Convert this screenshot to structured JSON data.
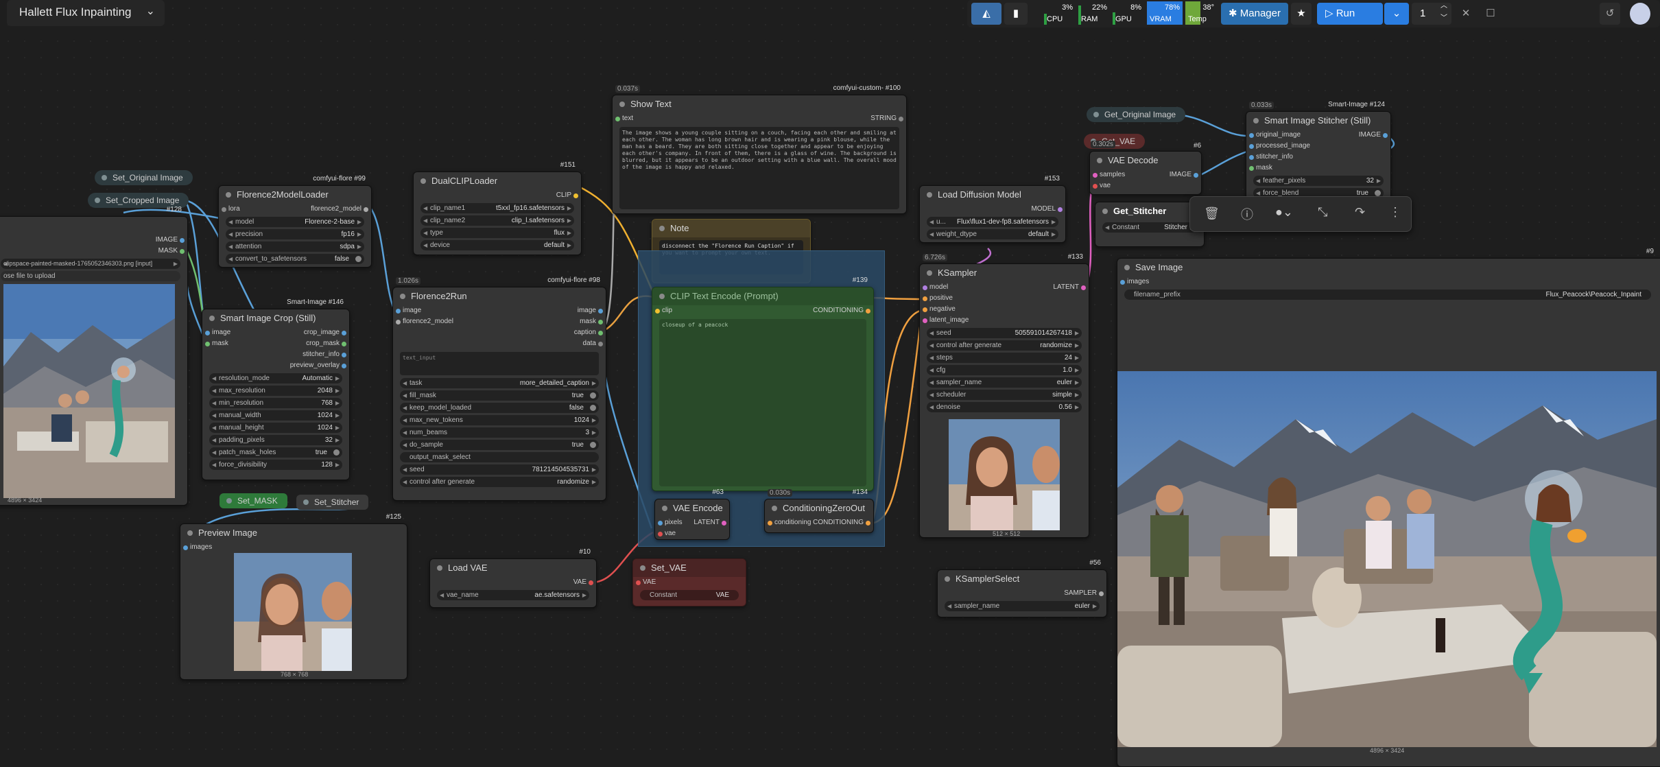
{
  "workflow": {
    "title": "Hallett Flux Inpainting"
  },
  "toolbar": {
    "stats": [
      {
        "label": "CPU",
        "value": "3%",
        "color": "#2ea043"
      },
      {
        "label": "RAM",
        "value": "22%",
        "color": "#2ea043"
      },
      {
        "label": "GPU",
        "value": "8%",
        "color": "#2ea043"
      },
      {
        "label": "VRAM",
        "value": "78%",
        "color": "#2a7de1"
      },
      {
        "label": "Temp",
        "value": "38°",
        "color": "#6fa83a"
      }
    ],
    "manager_label": "Manager",
    "run_label": "Run",
    "queue_count": "1"
  },
  "nodes": {
    "set_original": {
      "title": "Set_Original Image"
    },
    "set_cropped": {
      "title": "Set_Cropped Image"
    },
    "load_image": {
      "id": "#128",
      "outputs": [
        "IMAGE",
        "MASK"
      ],
      "filename": "clipspace-painted-masked-1765052346303.png [input]",
      "upload": "ose file to upload",
      "size": "4896 × 3424"
    },
    "florence_loader": {
      "title": "Florence2ModelLoader",
      "tag": "comfyui-flore #99",
      "in": "lora",
      "out": "florence2_model",
      "widgets": [
        {
          "l": "model",
          "v": "Florence-2-base"
        },
        {
          "l": "precision",
          "v": "fp16"
        },
        {
          "l": "attention",
          "v": "sdpa"
        },
        {
          "l": "convert_to_safetensors",
          "v": "false"
        }
      ]
    },
    "dualclip": {
      "title": "DualCLIPLoader",
      "id": "#151",
      "out": "CLIP",
      "widgets": [
        {
          "l": "clip_name1",
          "v": "t5xxl_fp16.safetensors"
        },
        {
          "l": "clip_name2",
          "v": "clip_l.safetensors"
        },
        {
          "l": "type",
          "v": "flux"
        },
        {
          "l": "device",
          "v": "default"
        }
      ]
    },
    "show_text": {
      "title": "Show Text",
      "timing": "0.037s",
      "tag": "comfyui-custom- #100",
      "in": "text",
      "out": "STRING",
      "text": "The image shows a young couple sitting on a couch, facing each other and smiling at each other. The woman has long brown hair and is wearing a pink blouse, while the man has a beard. They are both sitting close together and appear to be enjoying each other's company. In front of them, there is a glass of wine. The background is blurred, but it appears to be an outdoor setting with a blue wall. The overall mood of the image is happy and relaxed."
    },
    "note": {
      "title": "Note",
      "text": "disconnect the \"Florence Run Caption\" if you want to prompt your own text."
    },
    "smart_crop": {
      "title": "Smart Image Crop (Still)",
      "tag": "Smart-Image #146",
      "in": [
        "image",
        "mask"
      ],
      "out": [
        "crop_image",
        "crop_mask",
        "stitcher_info",
        "preview_overlay"
      ],
      "widgets": [
        {
          "l": "resolution_mode",
          "v": "Automatic"
        },
        {
          "l": "max_resolution",
          "v": "2048"
        },
        {
          "l": "min_resolution",
          "v": "768"
        },
        {
          "l": "manual_width",
          "v": "1024"
        },
        {
          "l": "manual_height",
          "v": "1024"
        },
        {
          "l": "padding_pixels",
          "v": "32"
        },
        {
          "l": "patch_mask_holes",
          "v": "true"
        },
        {
          "l": "force_divisibility",
          "v": "128"
        }
      ]
    },
    "florence_run": {
      "title": "Florence2Run",
      "timing": "1.026s",
      "tag": "comfyui-flore #98",
      "in": [
        "image",
        "florence2_model"
      ],
      "out": [
        "image",
        "mask",
        "caption",
        "data"
      ],
      "placeholder": "text_input",
      "widgets": [
        {
          "l": "task",
          "v": "more_detailed_caption"
        },
        {
          "l": "fill_mask",
          "v": "true"
        },
        {
          "l": "keep_model_loaded",
          "v": "false"
        },
        {
          "l": "max_new_tokens",
          "v": "1024"
        },
        {
          "l": "num_beams",
          "v": "3"
        },
        {
          "l": "do_sample",
          "v": "true"
        },
        {
          "l": "output_mask_select",
          "v": ""
        },
        {
          "l": "seed",
          "v": "781214504535731"
        },
        {
          "l": "control after generate",
          "v": "randomize"
        }
      ]
    },
    "clip_encode": {
      "title": "CLIP Text Encode (Prompt)",
      "id": "#139",
      "in": "clip",
      "out": "CONDITIONING",
      "text": "closeup of a peacock"
    },
    "vae_encode": {
      "title": "VAE Encode",
      "id": "#63",
      "in": [
        "pixels",
        "vae"
      ],
      "out": "LATENT"
    },
    "cond_zero": {
      "title": "ConditioningZeroOut",
      "timing": "0.030s",
      "id": "#134",
      "in": "conditioning",
      "out": "CONDITIONING"
    },
    "set_mask": {
      "title": "Set_MASK"
    },
    "set_stitcher": {
      "title": "Set_Stitcher"
    },
    "preview": {
      "title": "Preview Image",
      "id": "#125",
      "in": "images",
      "size": "768 × 768"
    },
    "load_vae": {
      "title": "Load VAE",
      "id": "#10",
      "out": "VAE",
      "widgets": [
        {
          "l": "vae_name",
          "v": "ae.safetensors"
        }
      ]
    },
    "set_vae": {
      "title": "Set_VAE",
      "in": "VAE",
      "widgets": [
        {
          "l": "Constant",
          "v": "VAE"
        }
      ]
    },
    "load_diffusion": {
      "title": "Load Diffusion Model",
      "id": "#153",
      "out": "MODEL",
      "widgets": [
        {
          "l": "u...",
          "v": "Flux\\flux1-dev-fp8.safetensors"
        },
        {
          "l": "weight_dtype",
          "v": "default"
        }
      ]
    },
    "ksampler": {
      "title": "KSampler",
      "timing": "6.726s",
      "id": "#133",
      "in": [
        "model",
        "positive",
        "negative",
        "latent_image"
      ],
      "out": "LATENT",
      "widgets": [
        {
          "l": "seed",
          "v": "505591014267418"
        },
        {
          "l": "control after generate",
          "v": "randomize"
        },
        {
          "l": "steps",
          "v": "24"
        },
        {
          "l": "cfg",
          "v": "1.0"
        },
        {
          "l": "sampler_name",
          "v": "euler"
        },
        {
          "l": "scheduler",
          "v": "simple"
        },
        {
          "l": "denoise",
          "v": "0.56"
        }
      ],
      "size": "512 × 512"
    },
    "ksampler_select": {
      "title": "KSamplerSelect",
      "id": "#56",
      "out": "SAMPLER",
      "widgets": [
        {
          "l": "sampler_name",
          "v": "euler"
        }
      ]
    },
    "get_original": {
      "title": "Get_Original Image"
    },
    "get_vae": {
      "title": "Get_VAE",
      "timing": "0.302s",
      "id": "#6"
    },
    "vae_decode": {
      "title": "VAE Decode",
      "in": [
        "samples",
        "vae"
      ],
      "out": "IMAGE"
    },
    "get_stitcher": {
      "title": "Get_Stitcher",
      "widgets": [
        {
          "l": "Constant",
          "v": "Stitcher"
        }
      ]
    },
    "stitcher": {
      "title": "Smart Image Stitcher (Still)",
      "timing": "0.033s",
      "tag": "Smart-Image #124",
      "in": [
        "original_image",
        "processed_image",
        "stitcher_info",
        "mask"
      ],
      "out": "IMAGE",
      "widgets": [
        {
          "l": "feather_pixels",
          "v": "32"
        },
        {
          "l": "force_blend",
          "v": "true"
        }
      ]
    },
    "save_image": {
      "title": "Save Image",
      "id": "#9",
      "in": "images",
      "widgets": [
        {
          "l": "filename_prefix",
          "v": "Flux_Peacock\\Peacock_Inpaint"
        }
      ],
      "size": "4896 × 3424"
    }
  }
}
